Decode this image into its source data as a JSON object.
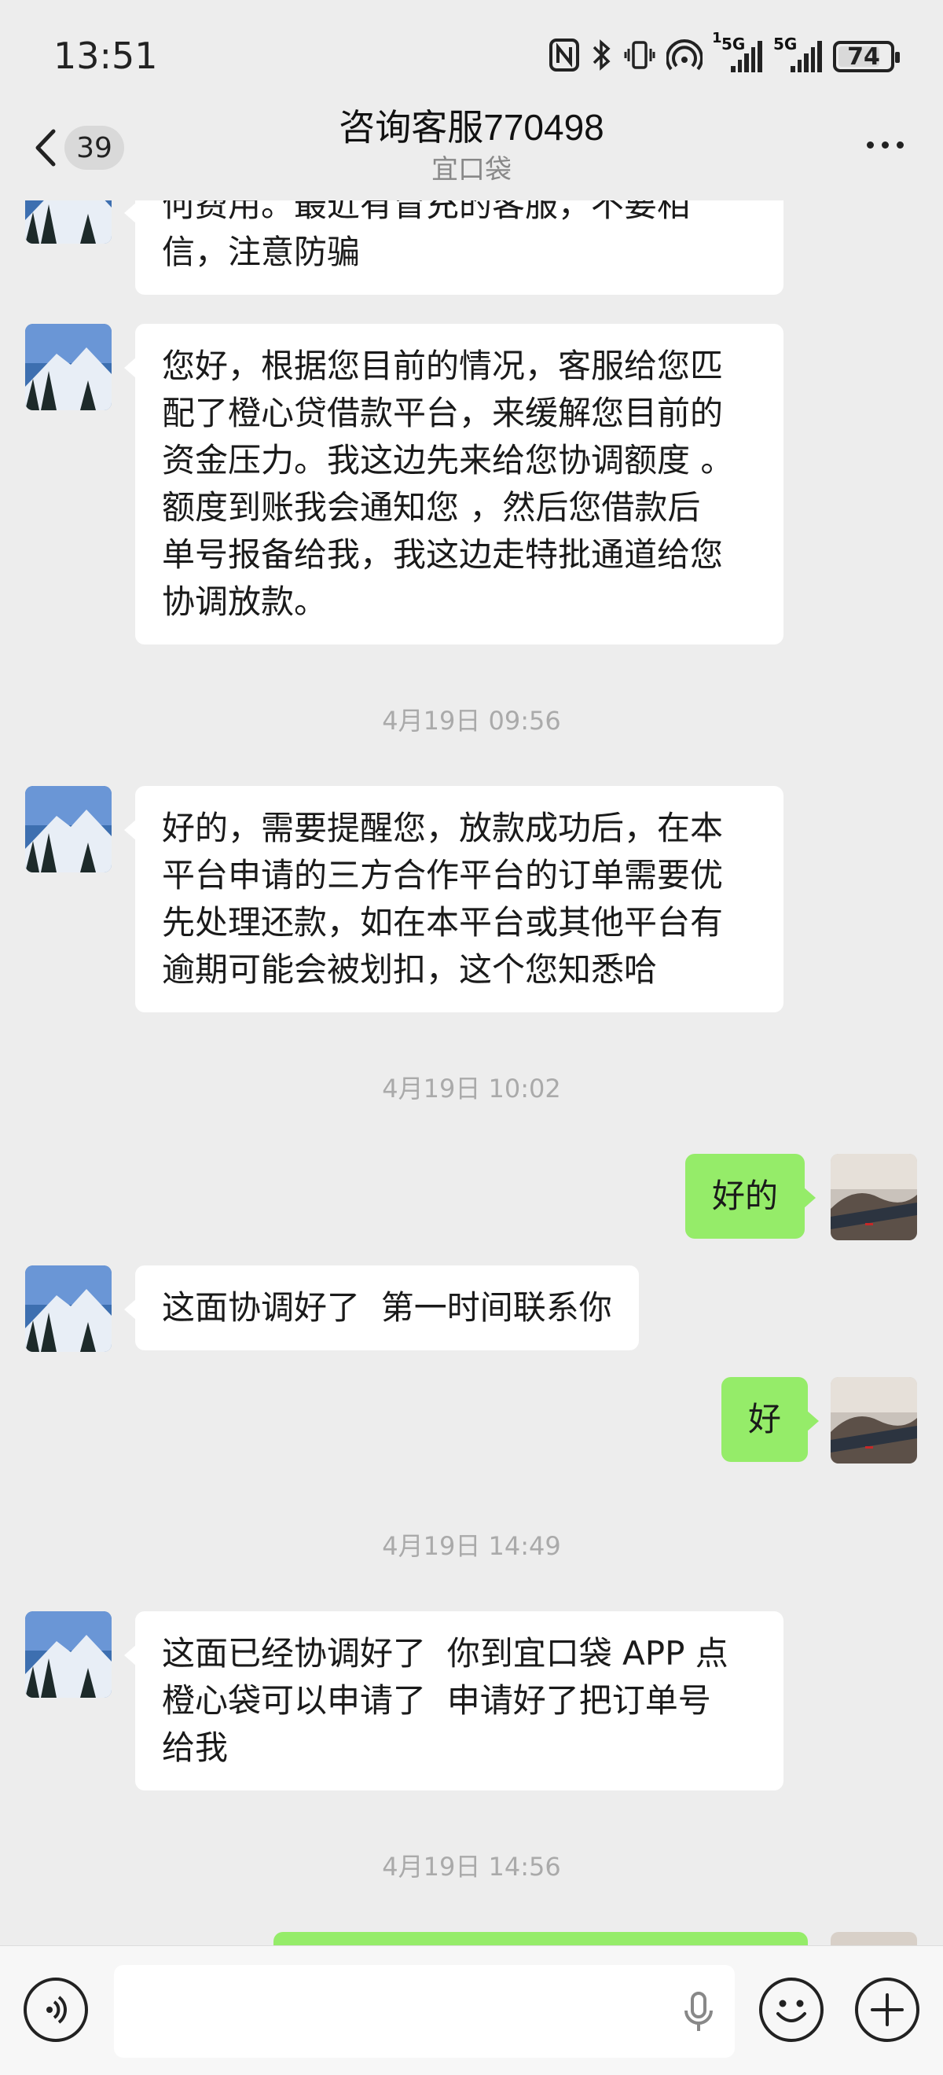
{
  "status_bar": {
    "time": "13:51",
    "battery": "74",
    "sim1_label": "5G",
    "sim2_label": "5G",
    "sim1_index": "1"
  },
  "header": {
    "back_count": "39",
    "title": "咨询客服770498",
    "subtitle": "宜口袋"
  },
  "messages": [
    {
      "side": "in",
      "text_lines": [
        "何费用。最近有冒充的客服，不要相",
        "信，注意防骗"
      ]
    },
    {
      "side": "in",
      "text_lines": [
        "您好，根据您目前的情况，客服给您匹",
        "配了橙心贷借款平台，来缓解您目前的",
        "资金压力。我这边先来给您协调额度 。",
        "额度到账我会通知您 ，然后您借款后",
        "单号报备给我，我这边走特批通道给您",
        "协调放款。"
      ]
    },
    {
      "timestamp": "4月19日 09:56"
    },
    {
      "side": "in",
      "text_lines": [
        "好的，需要提醒您，放款成功后，在本",
        "平台申请的三方合作平台的订单需要优",
        "先处理还款，如在本平台或其他平台有",
        "逾期可能会被划扣，这个您知悉哈"
      ]
    },
    {
      "timestamp": "4月19日 10:02"
    },
    {
      "side": "out",
      "text_lines": [
        "好的"
      ]
    },
    {
      "side": "in",
      "text_lines": [
        "这面协调好了  第一时间联系你"
      ]
    },
    {
      "side": "out",
      "text_lines": [
        "好"
      ]
    },
    {
      "timestamp": "4月19日 14:49"
    },
    {
      "side": "in",
      "text_lines": [
        "这面已经协调好了  你到宜口袋 APP 点",
        "橙心袋可以申请了  申请好了把订单号",
        "给我"
      ]
    },
    {
      "timestamp": "4月19日 14:56"
    }
  ],
  "colors": {
    "background": "#ededed",
    "incoming_bubble": "#ffffff",
    "outgoing_bubble": "#95ec69",
    "timestamp": "#aaaaaa"
  },
  "input_bar": {
    "voice_icon": "voice-icon",
    "mic_icon": "mic-icon",
    "emoji_icon": "emoji-icon",
    "plus_icon": "plus-icon"
  }
}
